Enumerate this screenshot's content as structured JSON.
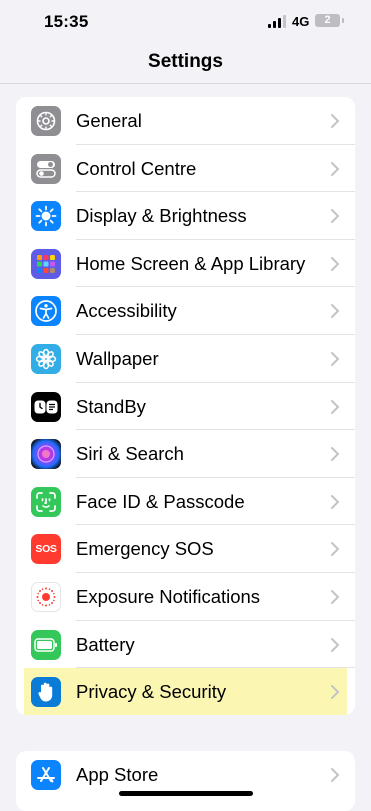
{
  "status_bar": {
    "time": "15:35",
    "network": "4G",
    "battery_level": "2",
    "signal_bars_active": 3,
    "signal_bars_total": 4
  },
  "nav": {
    "title": "Settings"
  },
  "groups": [
    {
      "items": [
        {
          "label": "General",
          "icon": "gear-icon",
          "color": "#8e8e93"
        },
        {
          "label": "Control Centre",
          "icon": "toggles-icon",
          "color": "#8e8e93"
        },
        {
          "label": "Display & Brightness",
          "icon": "sun-icon",
          "color": "#0a84ff"
        },
        {
          "label": "Home Screen & App Library",
          "icon": "app-grid-icon",
          "color": "#5e5ce6"
        },
        {
          "label": "Accessibility",
          "icon": "accessibility-icon",
          "color": "#0a84ff"
        },
        {
          "label": "Wallpaper",
          "icon": "flower-icon",
          "color": "#32ade6"
        },
        {
          "label": "StandBy",
          "icon": "standby-icon",
          "color": "#000000"
        },
        {
          "label": "Siri & Search",
          "icon": "siri-icon",
          "color": "#1c1c1e"
        },
        {
          "label": "Face ID & Passcode",
          "icon": "face-id-icon",
          "color": "#34c759"
        },
        {
          "label": "Emergency SOS",
          "icon": "sos-icon",
          "color": "#ff3b30",
          "icon_text": "SOS"
        },
        {
          "label": "Exposure Notifications",
          "icon": "exposure-icon",
          "color": "#ffffff"
        },
        {
          "label": "Battery",
          "icon": "battery-icon",
          "color": "#34c759"
        },
        {
          "label": "Privacy & Security",
          "icon": "hand-icon",
          "color": "#0a7bd6",
          "highlighted": true
        }
      ]
    },
    {
      "items": [
        {
          "label": "App Store",
          "icon": "app-store-icon",
          "color": "#0a84ff"
        }
      ]
    }
  ],
  "highlight_color": "#fbf6b2"
}
